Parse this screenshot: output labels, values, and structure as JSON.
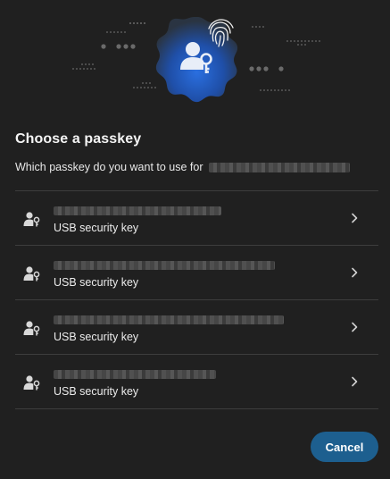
{
  "dialog": {
    "title": "Choose a passkey",
    "subtitle": "Which passkey do you want to use for",
    "cancel_label": "Cancel"
  },
  "passkeys": [
    {
      "type_label": "USB security key"
    },
    {
      "type_label": "USB security key"
    },
    {
      "type_label": "USB security key"
    },
    {
      "type_label": "USB security key"
    }
  ],
  "icons": {
    "hero": "passkey-badge-icon",
    "fingerprint": "fingerprint-icon",
    "row": "person-key-icon",
    "chevron": "chevron-right-icon"
  },
  "colors": {
    "background": "#202020",
    "accent": "#1d5f8f",
    "badge_blue": "#1e56b8",
    "divider": "#3d3d3d"
  }
}
